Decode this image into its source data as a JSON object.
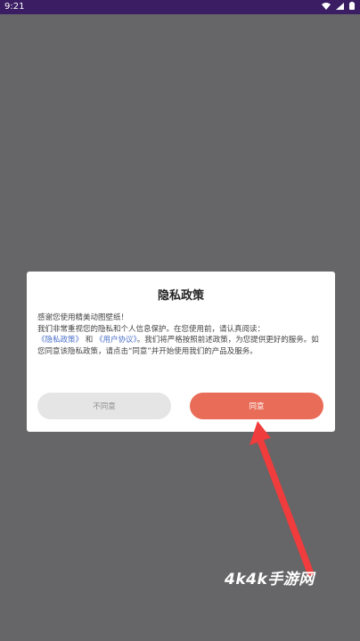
{
  "status": {
    "time": "9:21",
    "icons": [
      "wifi-icon",
      "signal-icon",
      "battery-icon"
    ]
  },
  "dialog": {
    "title": "隐私政策",
    "line1": "感谢您使用精美动图壁纸！",
    "line2": "我们非常重视您的隐私和个人信息保护。在您使用前，请认真阅读：",
    "link_privacy": "《隐私政策》",
    "and": "和",
    "link_user": "《用户协议》",
    "line3_rest": "。我们将严格按照前述政策，为您提供更好的服务。如您同意该隐私政策，请点击“同意”并开始使用我们的产品及服务。",
    "disagree_label": "不同意",
    "agree_label": "同意"
  },
  "watermark": "4k4k手游网",
  "colors": {
    "overlay": "#666567",
    "accent": "#e96c58",
    "status_bar": "#3a1d63",
    "link": "#4a6fc9",
    "arrow": "#f03c3c"
  }
}
